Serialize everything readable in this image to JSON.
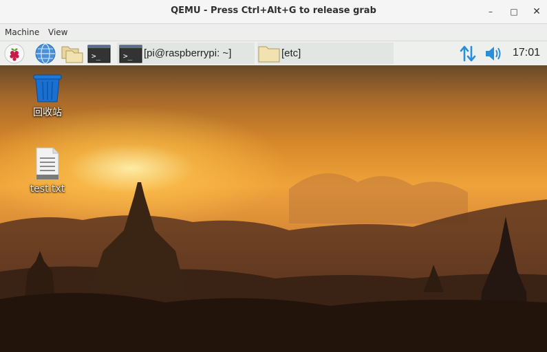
{
  "window": {
    "title": "QEMU - Press Ctrl+Alt+G to release grab",
    "controls": {
      "minimize": "–",
      "maximize": "□",
      "close": "✕"
    }
  },
  "menubar": {
    "items": [
      "Machine",
      "View"
    ]
  },
  "taskbar": {
    "launchers": [
      "raspberry-menu-icon",
      "web-browser-icon",
      "file-manager-icon",
      "terminal-icon"
    ],
    "windows": [
      {
        "icon": "terminal-icon",
        "label": "[pi@raspberrypi: ~]"
      },
      {
        "icon": "folder-icon",
        "label": "[etc]"
      }
    ],
    "tray": {
      "network_icon": "network-arrows-icon",
      "volume_icon": "speaker-icon",
      "clock": "17:01"
    },
    "colors": {
      "tray_blue": "#2a8fd6",
      "raspberry_red": "#c51a4a"
    }
  },
  "desktop": {
    "icons": [
      {
        "name": "trash-icon",
        "label": "回收站"
      },
      {
        "name": "text-file-icon",
        "label": "test.txt"
      }
    ]
  }
}
